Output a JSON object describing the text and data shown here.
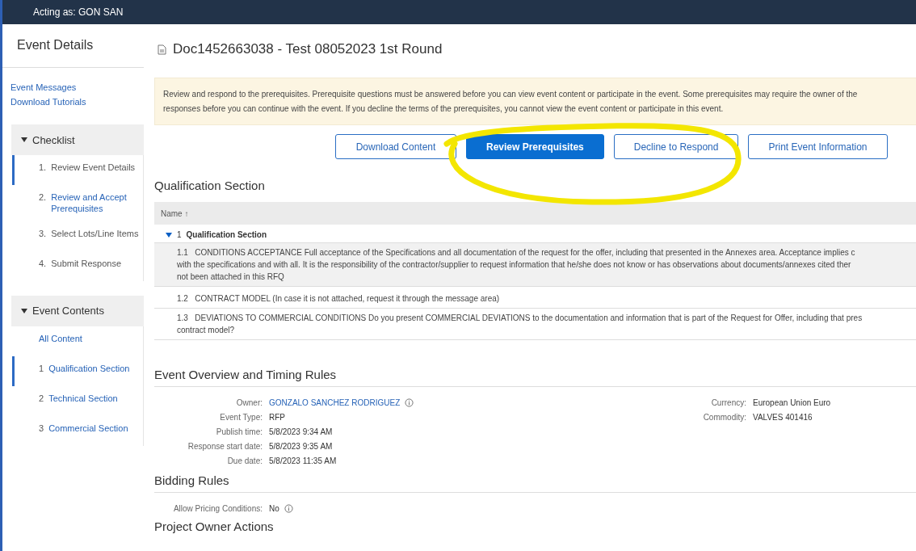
{
  "topbar": {
    "acting_as": "Acting as: GON SAN"
  },
  "sidebar": {
    "title": "Event Details",
    "links": [
      "Event Messages",
      "Download Tutorials"
    ],
    "groups": [
      {
        "title": "Checklist",
        "expanded": true,
        "items": [
          {
            "number": "1.",
            "label": "Review Event Details",
            "selected": true,
            "link": false
          },
          {
            "number": "2.",
            "label": "Review and Accept Prerequisites",
            "selected": false,
            "link": true
          },
          {
            "number": "3.",
            "label": "Select Lots/Line Items",
            "selected": false,
            "link": false
          },
          {
            "number": "4.",
            "label": "Submit Response",
            "selected": false,
            "link": false
          }
        ]
      },
      {
        "title": "Event Contents",
        "expanded": true,
        "items": [
          {
            "label": "All Content",
            "selected": false,
            "link": true
          },
          {
            "number": "1",
            "label": "Qualification Section",
            "selected": true,
            "link": true
          },
          {
            "number": "2",
            "label": "Technical Section",
            "selected": false,
            "link": true
          },
          {
            "number": "3",
            "label": "Commercial Section",
            "selected": false,
            "link": true
          }
        ]
      }
    ]
  },
  "page": {
    "title": "Doc1452663038 - Test 08052023 1st Round"
  },
  "notice": [
    "Review and respond to the prerequisites. Prerequisite questions must be answered before you can view event content or participate in the event. Some prerequisites may require the owner of the",
    "responses before you can continue with the event. If you decline the terms of the prerequisites, you cannot view the event content or participate in this event."
  ],
  "buttons": [
    {
      "label": "Download Content",
      "primary": false
    },
    {
      "label": "Review Prerequisites",
      "primary": true
    },
    {
      "label": "Decline to Respond",
      "primary": false
    },
    {
      "label": "Print Event Information",
      "primary": false
    }
  ],
  "annotation": {
    "kind": "ellipse"
  },
  "qualification": {
    "title": "Qualification Section",
    "column": "Name ↑",
    "group": {
      "number": "1",
      "label": "Qualification Section",
      "expanded": true
    },
    "rows": [
      {
        "number": "1.1",
        "lines": [
          "CONDITIONS ACCEPTANCE Full acceptance of the Specifications and all documentation of the request for the offer, including that presented in the Annexes area. Acceptance implies c",
          "with the specifications and with all. It is the responsibility of the contractor/supplier to request information that he/she does not know or has observations about documents/annexes cited ther",
          "not been attached in this RFQ"
        ],
        "shaded": true
      },
      {
        "number": "1.2",
        "lines": [
          "CONTRACT MODEL (In case it is not attached, request it through the message area)"
        ],
        "shaded": false
      },
      {
        "number": "1.3",
        "lines": [
          "DEVIATIONS TO COMMERCIAL CONDITIONS Do you present COMMERCIAL DEVIATIONS to the documentation and information that is part of the Request for Offer, including that pres",
          "contract model?"
        ],
        "shaded": false
      }
    ]
  },
  "overview": {
    "title": "Event Overview and Timing Rules",
    "left": [
      {
        "label": "Owner:",
        "value": "GONZALO SANCHEZ RODRIGUEZ",
        "link": true,
        "info": true
      },
      {
        "label": "Event Type:",
        "value": "RFP",
        "link": false,
        "info": false
      },
      {
        "label": "Publish time:",
        "value": "5/8/2023 9:34 AM",
        "link": false,
        "info": false
      },
      {
        "label": "Response start date:",
        "value": "5/8/2023 9:35 AM",
        "link": false,
        "info": false
      },
      {
        "label": "Due date:",
        "value": "5/8/2023 11:35 AM",
        "link": false,
        "info": false
      }
    ],
    "right": [
      {
        "label": "Currency:",
        "value": "European Union Euro"
      },
      {
        "label": "Commodity:",
        "value": "VALVES 401416"
      }
    ]
  },
  "bidding": {
    "title": "Bidding Rules",
    "fields": [
      {
        "label": "Allow Pricing Conditions:",
        "value": "No",
        "link": false,
        "info": true
      }
    ]
  },
  "next_section": {
    "title": "Project Owner Actions"
  }
}
